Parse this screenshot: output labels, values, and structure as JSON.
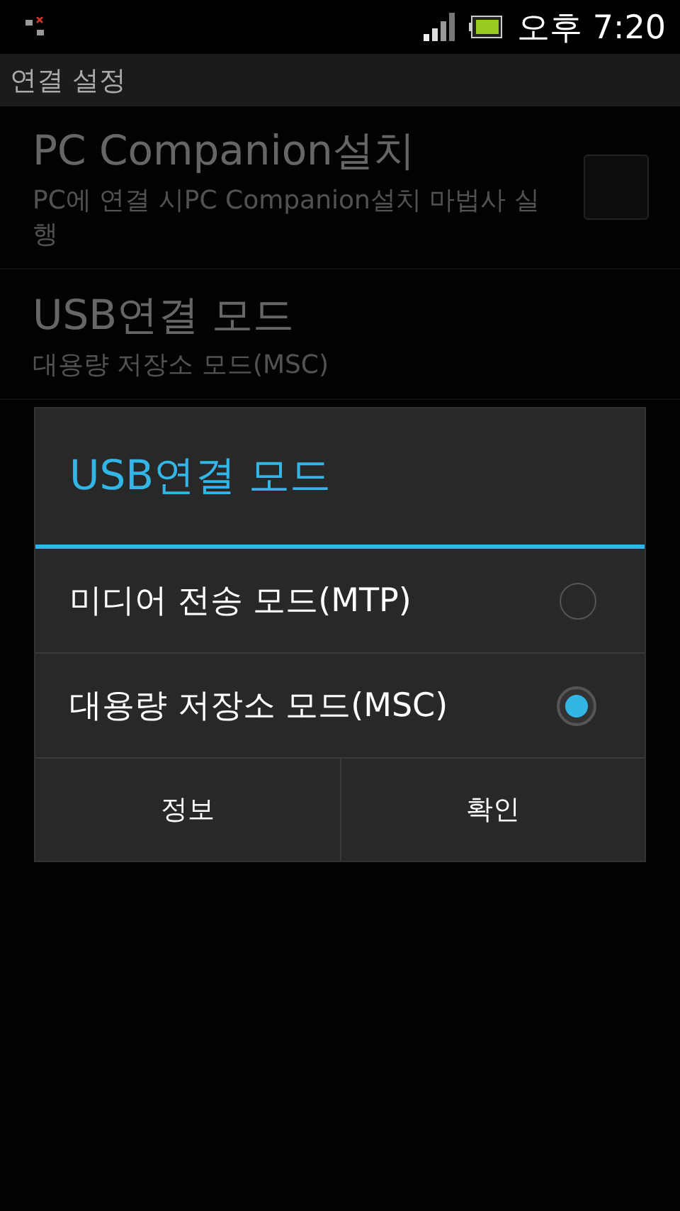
{
  "status_bar": {
    "time": "오후 7:20"
  },
  "title_bar": {
    "title": "연결 설정"
  },
  "settings": [
    {
      "kind": "checkbox",
      "title": "PC Companion설치",
      "summary": "PC에 연결 시PC Companion설치 마법사 실행",
      "checked": false
    },
    {
      "kind": "plain",
      "title": "USB연결 모드",
      "summary": "대용량 저장소 모드(MSC)"
    }
  ],
  "dialog": {
    "title": "USB연결 모드",
    "options": [
      {
        "label": "미디어 전송 모드(MTP)",
        "selected": false
      },
      {
        "label": "대용량 저장소 모드(MSC)",
        "selected": true
      }
    ],
    "buttons": [
      "정보",
      "확인"
    ]
  }
}
